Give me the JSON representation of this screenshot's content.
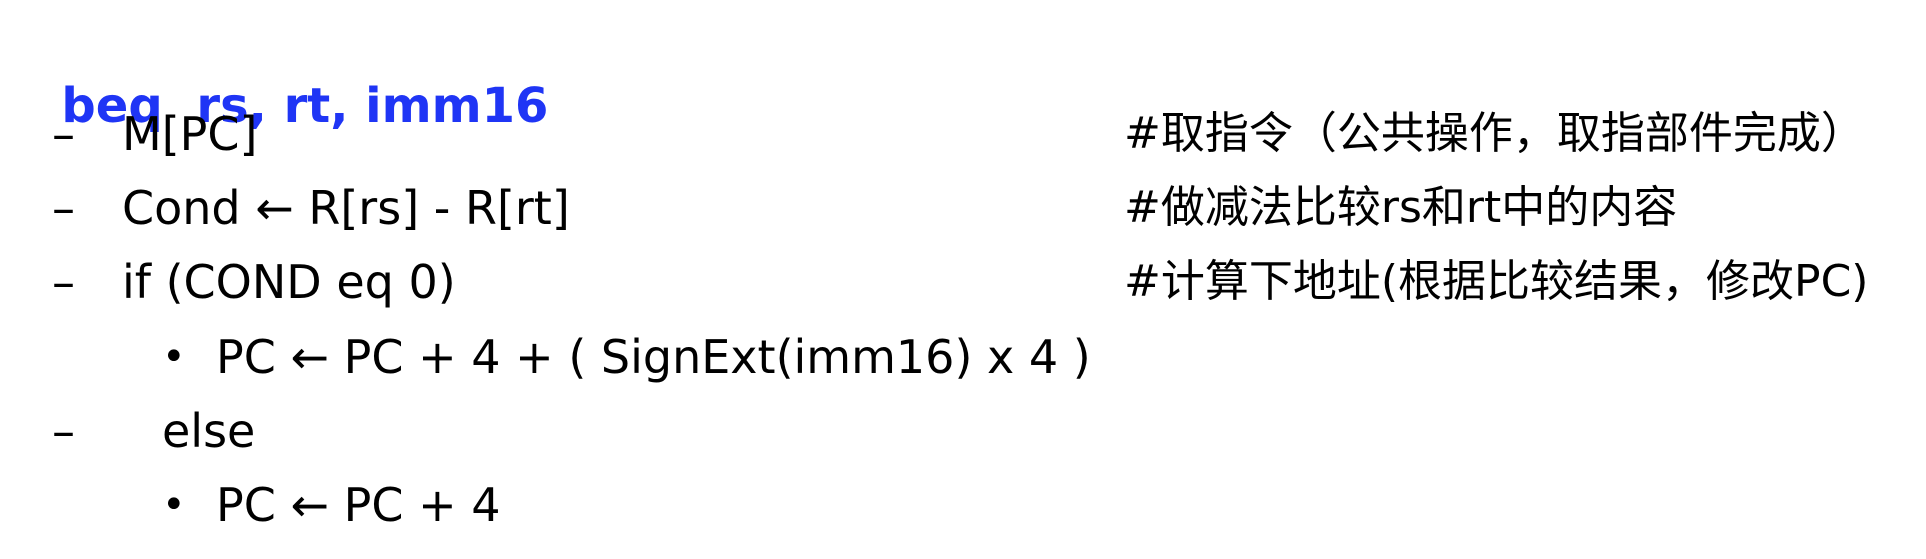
{
  "title": {
    "mnemonic": "beq",
    "operands": "rs, rt, imm16"
  },
  "lines": [
    {
      "marker": "–",
      "code": "M[PC]",
      "comment": "#取指令（公共操作，取指部件完成）"
    },
    {
      "marker": "–",
      "code": "Cond ← R[rs] - R[rt]",
      "comment": "#做减法比较rs和rt中的内容"
    },
    {
      "marker": "–",
      "code": "if (COND eq 0)",
      "comment": "#计算下地址(根据比较结果，修改PC)"
    },
    {
      "marker": "•",
      "code": "PC ← PC + 4 + ( SignExt(imm16) x 4 )"
    },
    {
      "marker": "–",
      "code": "else"
    },
    {
      "marker": "•",
      "code": "PC ← PC + 4"
    }
  ]
}
